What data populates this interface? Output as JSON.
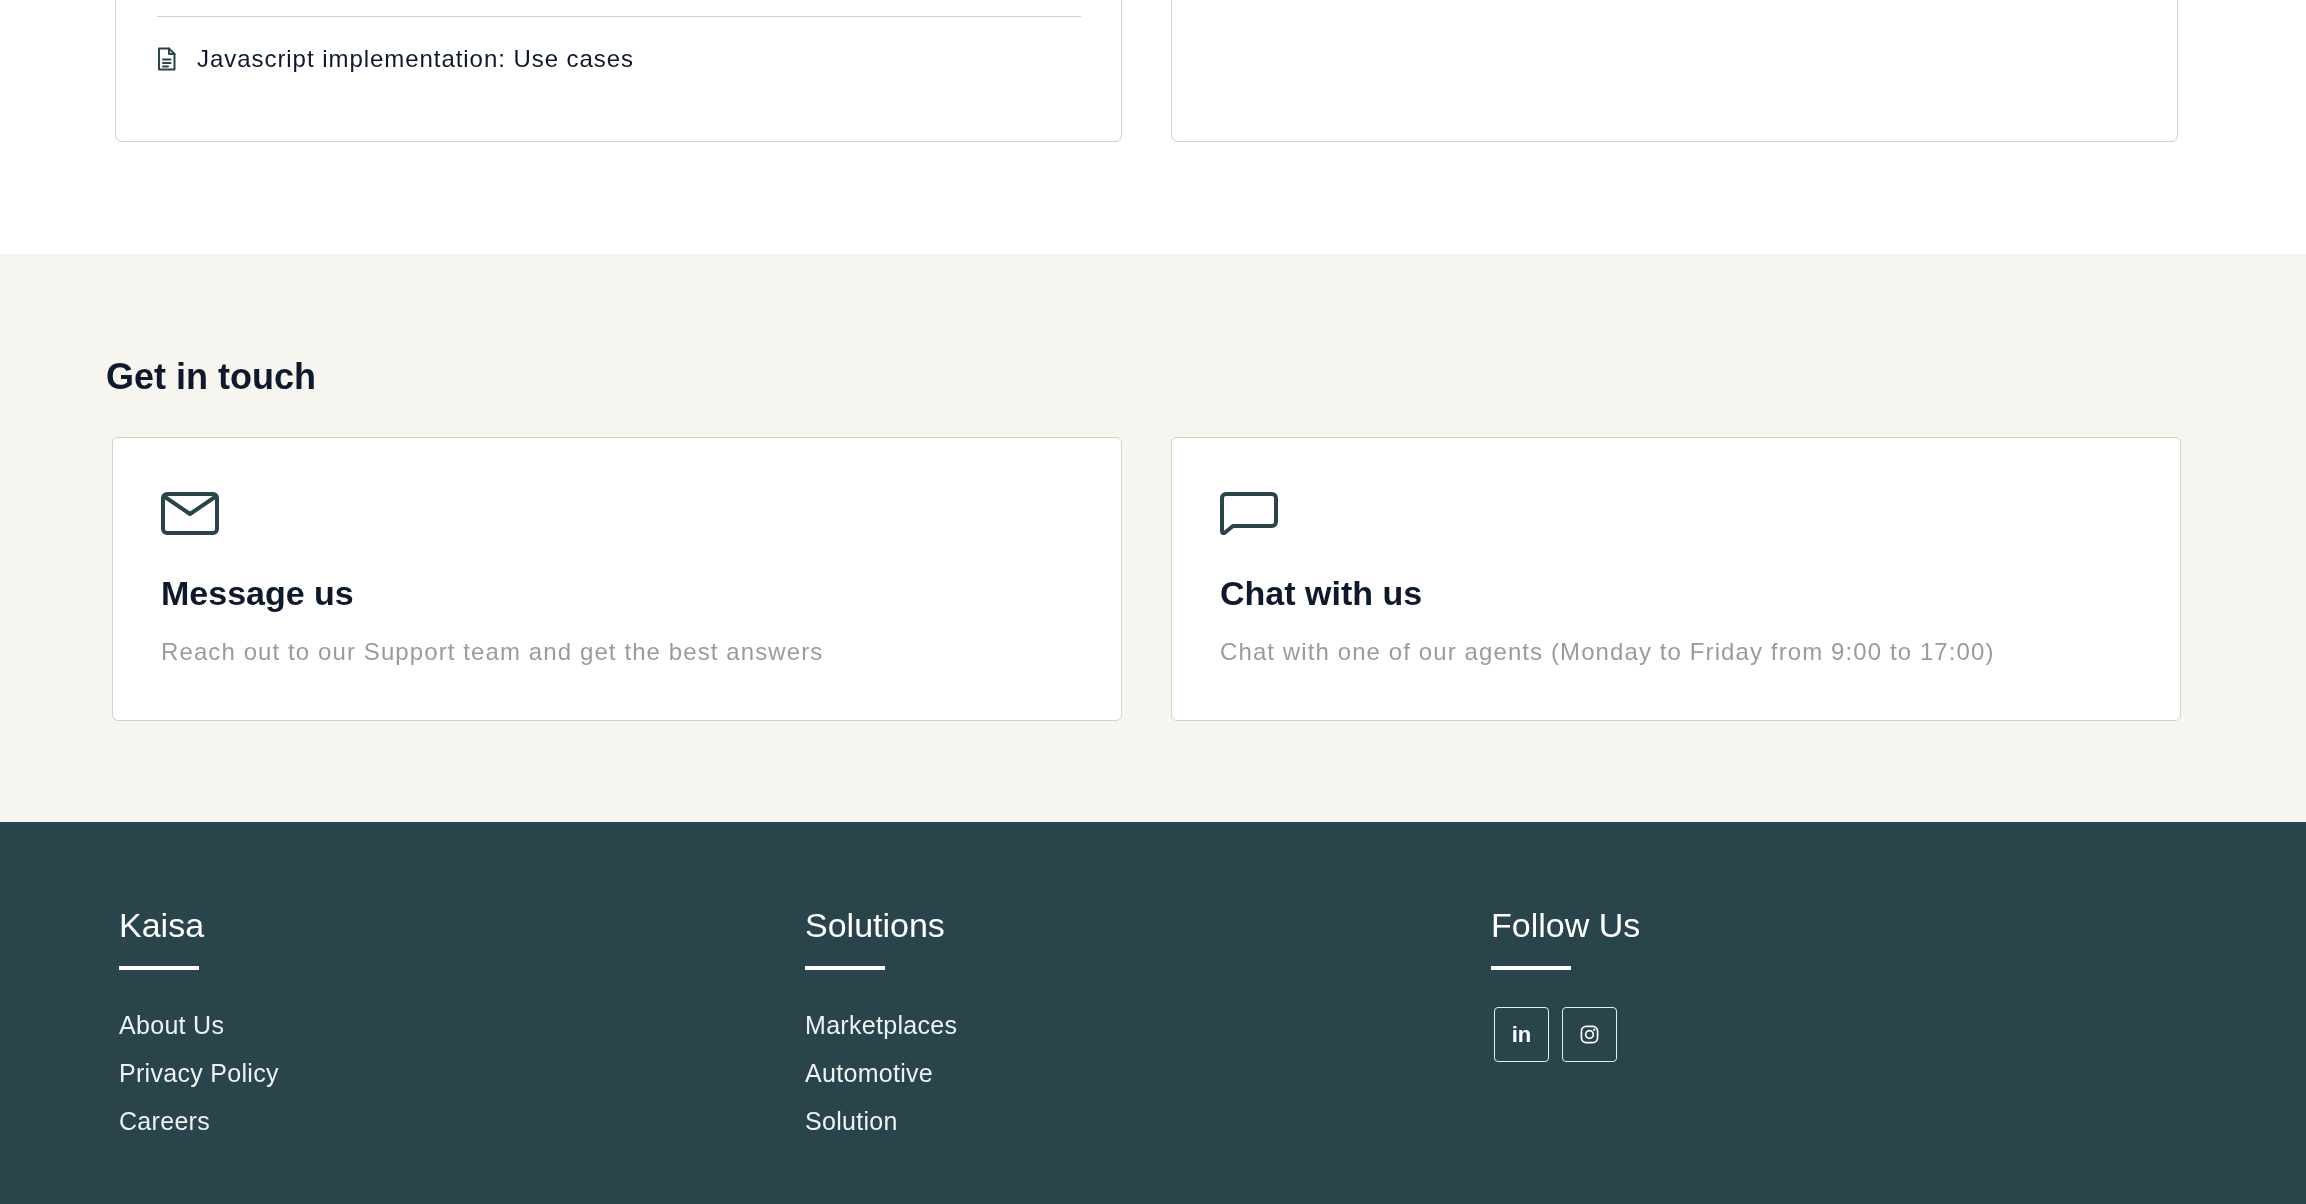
{
  "resource_cards": [
    {
      "kind": "links",
      "links": [
        {
          "label": "Javascript implementation: Use cases"
        }
      ]
    },
    {
      "kind": "blank"
    }
  ],
  "contact": {
    "title": "Get in touch",
    "cards": [
      {
        "kind": "email",
        "title": "Message us",
        "text": "Reach out to our Support team and get the best answers"
      },
      {
        "kind": "chat",
        "title": "Chat with us",
        "text": "Chat with one of our agents (Monday to Friday from 9:00 to 17:00)"
      }
    ]
  },
  "footer": {
    "columns": [
      {
        "title": "Kaisa",
        "links": [
          "About Us",
          "Privacy Policy",
          "Careers"
        ]
      },
      {
        "title": "Solutions",
        "links": [
          "Marketplaces",
          "Automotive",
          "Solution"
        ]
      },
      {
        "title": "Follow Us",
        "social": [
          {
            "kind": "glyph",
            "glyph": "in"
          },
          {
            "kind": "camera"
          }
        ]
      }
    ]
  }
}
